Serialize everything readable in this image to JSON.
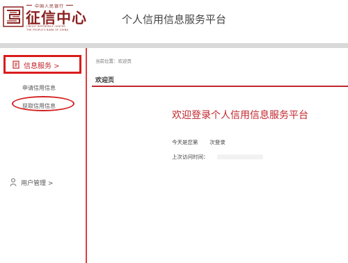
{
  "header": {
    "logo_top_text": "中国人民银行",
    "logo_main_text": "征信中心",
    "logo_en_line1": "CREDIT REFERENCE CENTER",
    "logo_en_line2": "THE PEOPLE'S BANK OF CHINA",
    "platform_title": "个人信用信息服务平台"
  },
  "sidebar": {
    "primary_item_label": "信息服务 >",
    "sub_items": [
      "申请信用信息",
      "获取信用信息"
    ],
    "user_mgmt_label": "用户管理 >"
  },
  "main": {
    "breadcrumb": "当前位置：欢迎页",
    "page_title": "欢迎页",
    "welcome_title": "欢迎登录个人信用信息服务平台",
    "login_count_prefix": "今天是您第",
    "login_count_suffix": "次登录",
    "last_visit_label": "上次访问时间："
  },
  "colors": {
    "brand_red": "#c1272d",
    "highlight_red": "#d91c1c",
    "header_bar": "#d9d9d9"
  }
}
